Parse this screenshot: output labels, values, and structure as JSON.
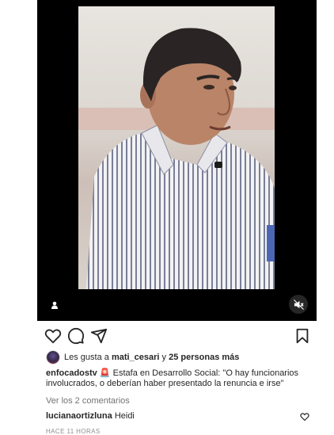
{
  "likes": {
    "prefix": "Les gusta a",
    "user": "mati_cesari",
    "joiner": "y",
    "others": "25 personas más"
  },
  "caption": {
    "user": "enfocadostv",
    "emoji": "🚨",
    "text": "Estafa en Desarrollo Social: \"O hay funcionarios involucrados, o deberían haber presentado la renuncia e irse\""
  },
  "comments_link": "Ver los 2 comentarios",
  "comment": {
    "user": "lucianaortizluna",
    "text": "Heidi"
  },
  "timestamp": "HACE 11 HORAS",
  "icons": {
    "user_tag": "user-tag-icon",
    "mute": "speaker-muted-icon",
    "like": "heart-icon",
    "comment": "comment-bubble-icon",
    "share": "paper-plane-icon",
    "save": "bookmark-icon"
  },
  "colors": {
    "media_bg": "#000000",
    "text": "#262626",
    "muted_text": "#737373"
  }
}
